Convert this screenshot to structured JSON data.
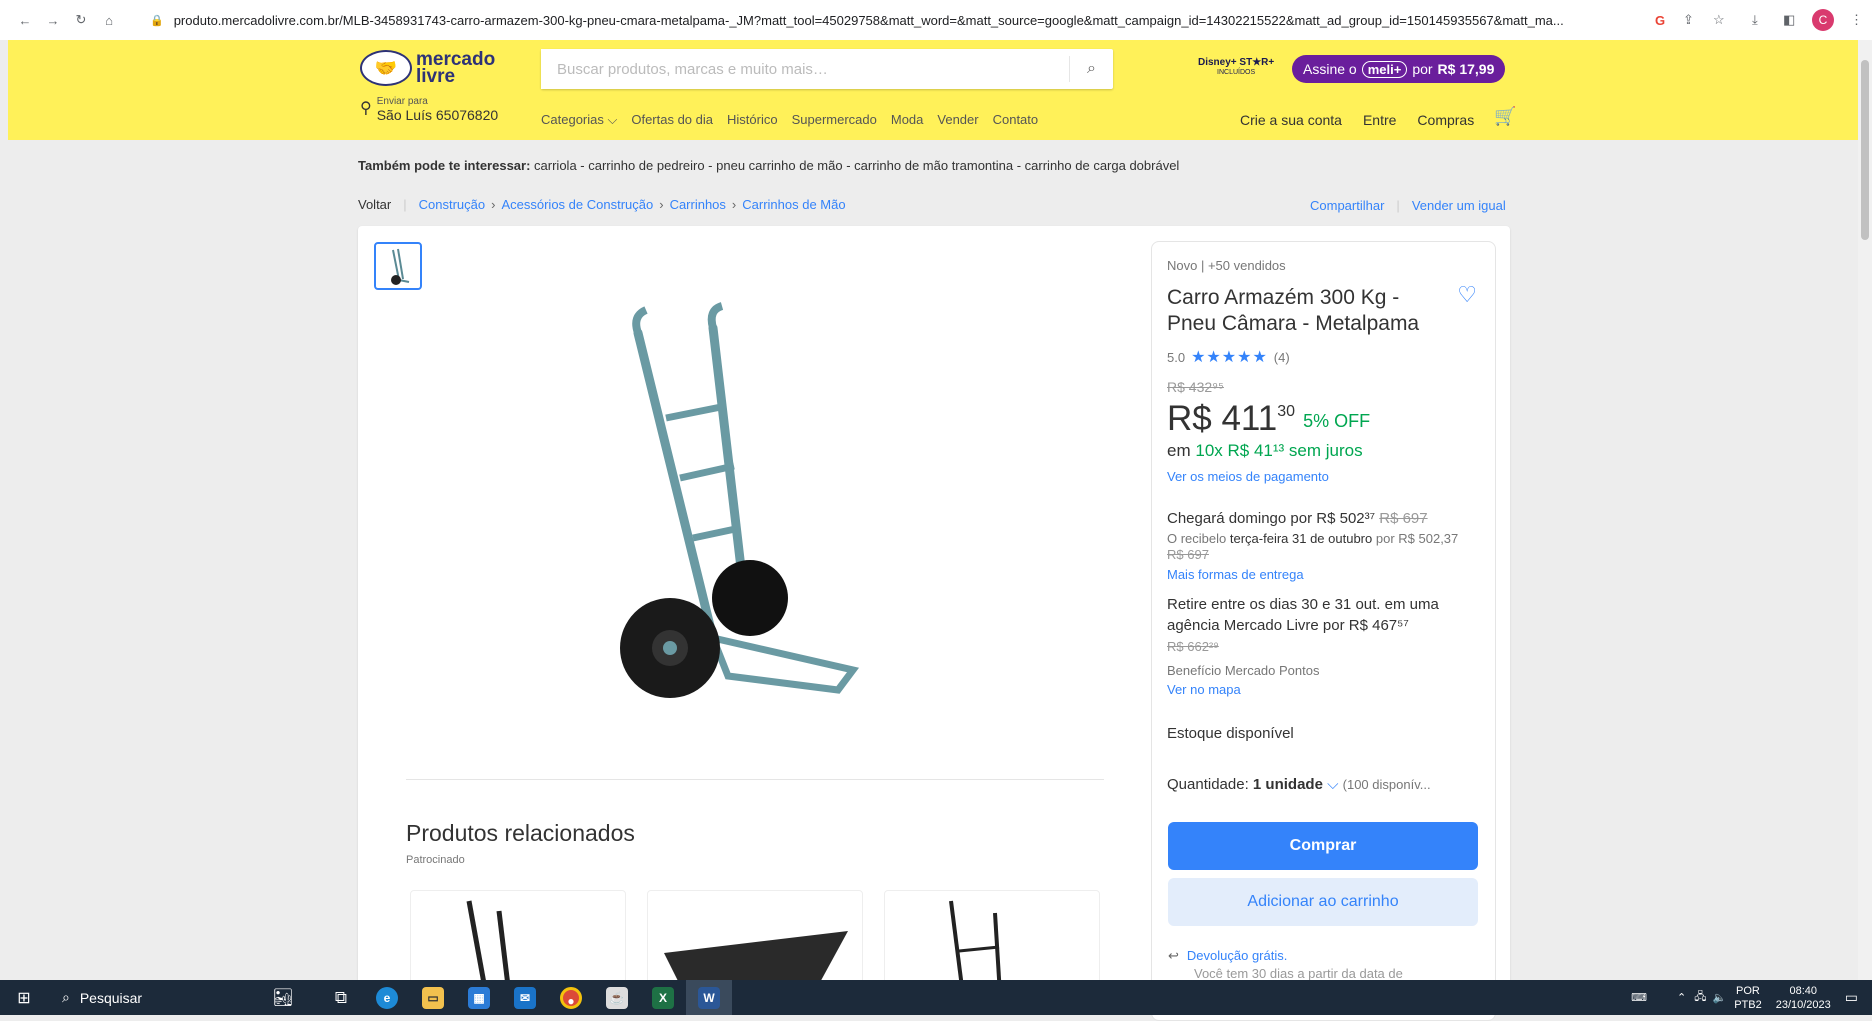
{
  "browser": {
    "url": "produto.mercadolivre.com.br/MLB-3458931743-carro-armazem-300-kg-pneu-cmara-metalpama-_JM?matt_tool=45029758&matt_word=&matt_source=google&matt_campaign_id=14302215522&matt_ad_group_id=150145935567&matt_ma...",
    "profile_initial": "C"
  },
  "header": {
    "logo_line1": "mercado",
    "logo_line2": "livre",
    "search_placeholder": "Buscar produtos, marcas e muito mais…",
    "disney_label": "Disney+ ST★R+",
    "disney_sub": "INCLUÍDOS",
    "promo_prefix": "Assine o",
    "promo_pill": "meli+",
    "promo_mid": "por",
    "promo_price": "R$ 17,99",
    "location_small": "Enviar para",
    "location_city": "São Luís 65076820",
    "nav": [
      "Categorias ⌵",
      "Ofertas do dia",
      "Histórico",
      "Supermercado",
      "Moda",
      "Vender",
      "Contato"
    ],
    "user_nav": [
      "Crie a sua conta",
      "Entre",
      "Compras"
    ]
  },
  "interest": {
    "label": "Também pode te interessar:",
    "items": "carriola - carrinho de pedreiro - pneu carrinho de mão - carrinho de mão tramontina - carrinho de carga dobrável"
  },
  "breadcrumb": {
    "back": "Voltar",
    "items": [
      "Construção",
      "Acessórios de Construção",
      "Carrinhos",
      "Carrinhos de Mão"
    ],
    "share": "Compartilhar",
    "sell": "Vender um igual"
  },
  "product": {
    "condition": "Novo  |  +50 vendidos",
    "title": "Carro Armazém 300 Kg - Pneu Câmara - Metalpama",
    "rating_value": "5.0",
    "rating_stars": "★★★★★",
    "rating_count": "(4)",
    "old_price": "R$ 432⁹⁵",
    "price": "R$ 411",
    "cents": "30",
    "discount": "5% OFF",
    "installments_prefix": "em",
    "installments": "10x R$ 41¹³ sem juros",
    "payment_link": "Ver os meios de pagamento",
    "delivery_main": "Chegará domingo por R$ 502³⁷",
    "delivery_strike": "R$ 697",
    "receive_prefix": "O recibelo",
    "receive_date": "terça-feira 31 de outubro",
    "receive_suffix": "por R$ 502,37",
    "receive_strike": "R$ 697",
    "more_delivery": "Mais formas de entrega",
    "pickup_text": "Retire entre os dias 30 e 31 out. em uma agência Mercado Livre por R$ 467⁵⁷",
    "pickup_strike": "R$ 662²⁹",
    "benefit": "Benefício Mercado Pontos",
    "map_link": "Ver no mapa",
    "stock": "Estoque disponível",
    "qty_label": "Quantidade:",
    "qty_value": "1 unidade",
    "qty_avail": "(100 disponív...",
    "buy_button": "Comprar",
    "cart_button": "Adicionar ao carrinho",
    "returns_link": "Devolução grátis.",
    "returns_sub": "Você tem 30 dias a partir da data de"
  },
  "related": {
    "title": "Produtos relacionados",
    "subtitle": "Patrocinado"
  },
  "taskbar": {
    "search": "Pesquisar",
    "lang": "POR",
    "lang2": "PTB2",
    "time": "08:40",
    "date": "23/10/2023"
  }
}
